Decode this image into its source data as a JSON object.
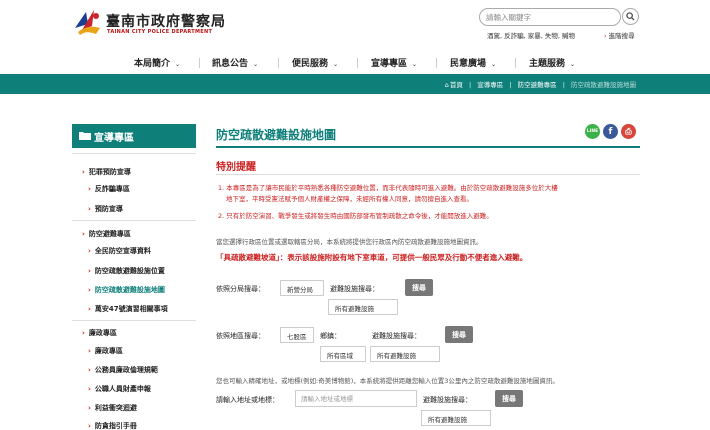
{
  "header": {
    "logo_cn": "臺南市政府警察局",
    "logo_en": "TAINAN CITY POLICE DEPARTMENT",
    "search_placeholder": "請輸入關鍵字",
    "hot_words": "酒駕, 反詐騙, 家暴, 失物, 贓物",
    "advanced_search": "進階搜尋"
  },
  "nav": {
    "items": [
      "本局簡介",
      "訊息公告",
      "便民服務",
      "宣導專區",
      "民意廣場",
      "主題服務"
    ]
  },
  "breadcrumb": [
    "首頁",
    "宣導專區",
    "防空避難專區",
    "防空疏散避難設施地圖"
  ],
  "sidebar": {
    "title": "宣導專區",
    "groups": [
      {
        "label": "犯罪預防宣導",
        "children": [
          "反詐騙專區",
          "預防宣導"
        ]
      },
      {
        "label": "防空避難專區",
        "children": [
          "全民防空宣導資料",
          "防空疏散避難設施位置",
          "防空疏散避難設施地圖",
          "萬安47號演習相關事項"
        ]
      },
      {
        "label": "廉政專區",
        "children": [
          "廉政專區",
          "公務員廉政倫理規範",
          "公職人員財產申報",
          "利益衝突迴避",
          "防貪指引手冊"
        ]
      }
    ]
  },
  "main": {
    "title": "防空疏散避難設施地圖",
    "share": {
      "line": "LINE",
      "facebook": "f",
      "print": "⎙"
    },
    "notice_title": "特別提醒",
    "notices": [
      "1. 本專區是為了讓市民能於平時熟悉各種防空避難位置，而非代表隨時可進入避難。由於防空疏散避難設施多位於大樓",
      "地下室，平時受憲法賦予個人財產權之保障，未經所有權人同意，請勿擅自進入查看。",
      "2. 只有於防空演習、戰爭發生或將發生時由國防部發布管制疏散之命令後，才能開放進入避難。"
    ],
    "intro": "當您選擇行政區位置或選取轄區分局，本系統將提供您行政區內防空疏散避難設施地圖資訊。",
    "warning": "「具疏散避難坡道」：表示該設施附設有地下室車道，可提供一般民眾及行動不便者進入避難。",
    "form1": {
      "label": "依照分局搜尋：",
      "district": "新營分局",
      "type_label": "避難設施搜尋：",
      "type_value": "所有避難設施",
      "button": "搜尋"
    },
    "form2": {
      "label": "依照地區搜尋：",
      "district": "七股區",
      "town_label": "鄉鎮：",
      "town_value": "所有區域",
      "type_label": "避難設施搜尋：",
      "type_value": "所有避難設施",
      "button": "搜尋"
    },
    "addr_intro": "您也可輸入精確地址，或地標(例如:奇美博物館)，本系統將提供距離您輸入位置3公里內之防空疏散避難設施地圖資訊。",
    "form3": {
      "label": "請輸入地址或地標：",
      "placeholder": "請輸入地址或地標",
      "type_label": "避難設施搜尋：",
      "type_value": "所有避難設施",
      "button": "搜尋"
    }
  }
}
